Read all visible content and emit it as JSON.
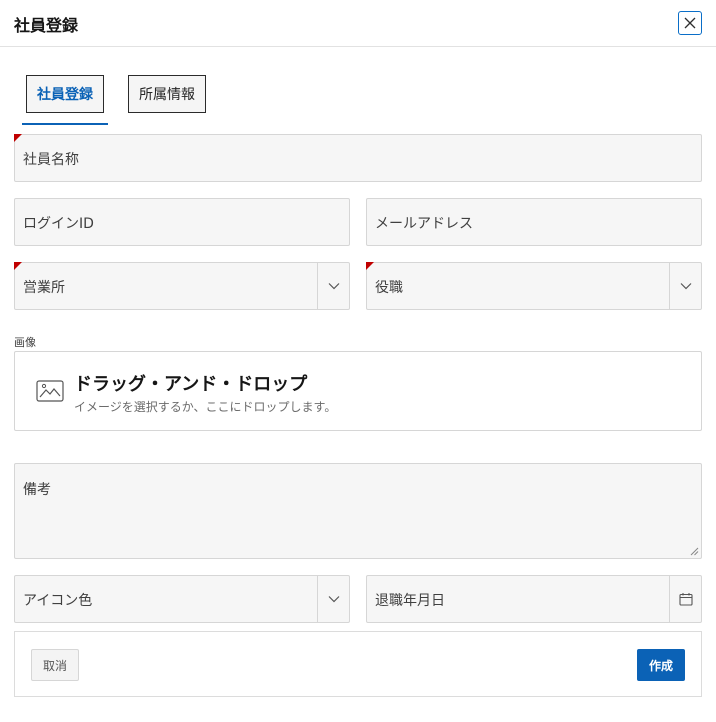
{
  "dialog": {
    "title": "社員登録",
    "close_icon": "close-icon"
  },
  "tabs": [
    {
      "label": "社員登録",
      "active": true
    },
    {
      "label": "所属情報",
      "active": false
    }
  ],
  "form": {
    "employee_name": {
      "label": "社員名称",
      "required": true
    },
    "login_id": {
      "label": "ログインID"
    },
    "email": {
      "label": "メールアドレス"
    },
    "office": {
      "label": "営業所",
      "required": true,
      "icon": "chevron-down-icon"
    },
    "role": {
      "label": "役職",
      "required": true,
      "icon": "chevron-down-icon"
    },
    "image": {
      "label": "画像",
      "drop_title": "ドラッグ・アンド・ドロップ",
      "drop_hint": "イメージを選択するか、ここにドロップします。",
      "icon": "image-icon"
    },
    "notes": {
      "label": "備考"
    },
    "icon_color": {
      "label": "アイコン色",
      "icon": "chevron-down-icon"
    },
    "retire_date": {
      "label": "退職年月日",
      "icon": "calendar-icon"
    }
  },
  "footer": {
    "cancel_label": "取消",
    "create_label": "作成"
  },
  "colors": {
    "accent": "#0b62b6",
    "required_marker": "#c00000",
    "field_bg": "#f6f6f6"
  }
}
